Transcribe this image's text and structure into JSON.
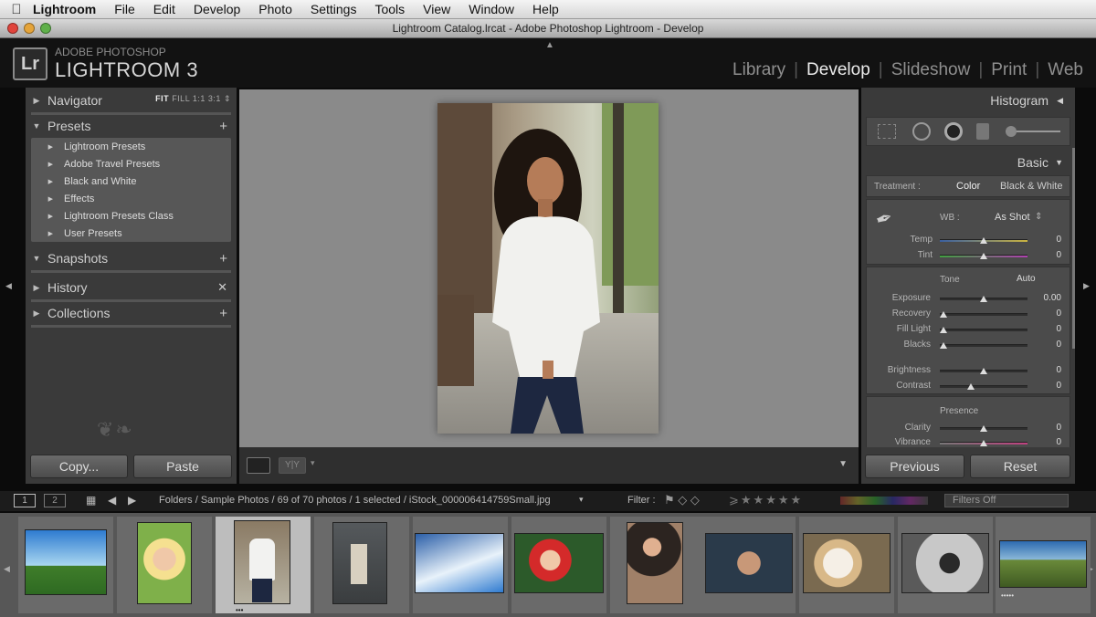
{
  "menubar": {
    "apple": "",
    "items": [
      "Lightroom",
      "File",
      "Edit",
      "Develop",
      "Photo",
      "Settings",
      "Tools",
      "View",
      "Window",
      "Help"
    ]
  },
  "window": {
    "title": "Lightroom Catalog.lrcat - Adobe Photoshop Lightroom - Develop"
  },
  "brand": {
    "badge": "Lr",
    "line1": "ADOBE PHOTOSHOP",
    "line2": "LIGHTROOM 3"
  },
  "modules": [
    "Library",
    "Develop",
    "Slideshow",
    "Print",
    "Web"
  ],
  "left": {
    "navigator": "Navigator",
    "nav_opts": [
      "FIT",
      "FILL",
      "1:1",
      "3:1"
    ],
    "presets": "Presets",
    "preset_items": [
      "Lightroom Presets",
      "Adobe Travel Presets",
      "Black and White",
      "Effects",
      "Lightroom Presets Class",
      "User Presets"
    ],
    "snapshots": "Snapshots",
    "history": "History",
    "collections": "Collections",
    "copy": "Copy...",
    "paste": "Paste"
  },
  "right": {
    "histogram": "Histogram",
    "basic": "Basic",
    "treatment": "Treatment :",
    "color": "Color",
    "bw": "Black & White",
    "wb": "WB :",
    "wb_value": "As Shot",
    "temp": "Temp",
    "temp_val": "0",
    "tint": "Tint",
    "tint_val": "0",
    "tone": "Tone",
    "auto": "Auto",
    "exposure": "Exposure",
    "exposure_val": "0.00",
    "recovery": "Recovery",
    "recovery_val": "0",
    "filllight": "Fill Light",
    "filllight_val": "0",
    "blacks": "Blacks",
    "blacks_val": "0",
    "brightness": "Brightness",
    "brightness_val": "0",
    "contrast": "Contrast",
    "contrast_val": "0",
    "presence": "Presence",
    "clarity": "Clarity",
    "clarity_val": "0",
    "vibrance": "Vibrance",
    "vibrance_val": "0",
    "previous": "Previous",
    "reset": "Reset"
  },
  "filmbar": {
    "view1": "1",
    "view2": "2",
    "path": "Folders / Sample Photos / 69 of 70 photos / 1 selected / iStock_000006414759Small.jpg",
    "filter": "Filter :",
    "filters_off": "Filters Off"
  },
  "colors": {
    "accent": "#ececec",
    "panel": "#3a3a3a",
    "center_bg": "#8a8a8a"
  }
}
